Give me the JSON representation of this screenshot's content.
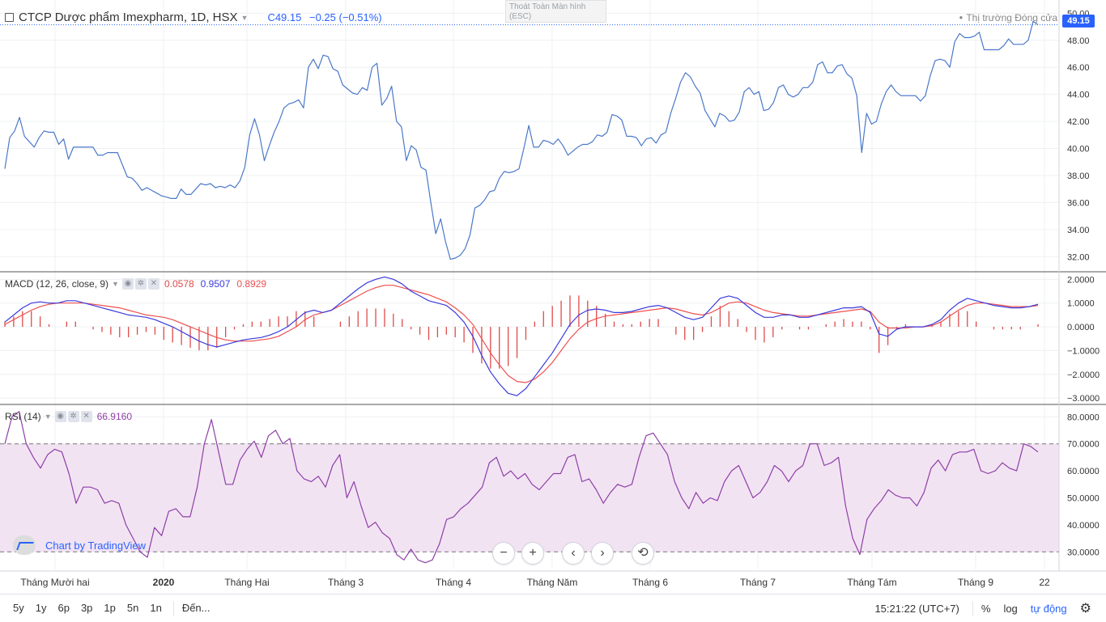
{
  "legend": {
    "symbol": "CTCP Dược phẩm Imexpharm, 1D, HSX",
    "close_label": "C",
    "close_value": "49.15",
    "change": "−0.25 (−0.51%)"
  },
  "fullscreen_hint": {
    "line1": "Thoát Toàn Màn hình",
    "line2": "(ESC)"
  },
  "market_status": "Thị trường Đóng cửa",
  "last_price_badge": "49.15",
  "macd_legend": {
    "label": "MACD (12, 26, close, 9)",
    "hist": "0.0578",
    "macd": "0.9507",
    "signal": "0.8929"
  },
  "rsi_legend": {
    "label": "RSI (14)",
    "value": "66.9160"
  },
  "watermark": "Chart by TradingView",
  "price_axis": [
    "50.00",
    "48.00",
    "46.00",
    "44.00",
    "42.00",
    "40.00",
    "38.00",
    "36.00",
    "34.00",
    "32.00"
  ],
  "macd_axis": [
    "2.0000",
    "1.0000",
    "0.0000",
    "−1.0000",
    "−2.0000",
    "−3.0000"
  ],
  "rsi_axis": [
    "80.0000",
    "70.0000",
    "60.0000",
    "50.0000",
    "40.0000",
    "30.0000"
  ],
  "time_axis": [
    "Tháng Mười hai",
    "2020",
    "Tháng Hai",
    "Tháng 3",
    "Tháng 4",
    "Tháng Năm",
    "Tháng 6",
    "Tháng 7",
    "Tháng Tám",
    "Tháng 9",
    "22"
  ],
  "nav_buttons": {
    "zoom_out": "−",
    "zoom_in": "+",
    "back": "‹",
    "forward": "›",
    "reset": "⟲"
  },
  "timeframes": [
    "5y",
    "1y",
    "6p",
    "3p",
    "1p",
    "5n",
    "1n"
  ],
  "goto_label": "Đến...",
  "clock": "15:21:22 (UTC+7)",
  "percent_label": "%",
  "log_label": "log",
  "auto_label": "tự động",
  "colors": {
    "price_line": "#4a78c9",
    "macd_line": "#3b3bdc",
    "signal_line": "#ef4f4f",
    "histogram": "#e04a4a",
    "rsi_line": "#8e3fa6",
    "rsi_band": "#f2e3f3",
    "accent": "#2962ff"
  },
  "chart_data": [
    {
      "type": "line",
      "name": "price",
      "ylim": [
        31,
        50.5
      ],
      "ytick_labels": [
        "50.00",
        "48.00",
        "46.00",
        "44.00",
        "42.00",
        "40.00",
        "38.00",
        "36.00",
        "34.00",
        "32.00"
      ],
      "values": [
        38.5,
        40.8,
        41.3,
        42.3,
        40.9,
        40.5,
        40.1,
        40.8,
        41.3,
        41.2,
        41.2,
        40.3,
        40.7,
        39.2,
        40.1,
        40.1,
        40.1,
        40.1,
        40.1,
        39.5,
        39.5,
        39.7,
        39.7,
        39.7,
        38.8,
        37.9,
        37.8,
        37.4,
        36.9,
        37.1,
        36.9,
        36.7,
        36.5,
        36.4,
        36.3,
        36.3,
        37.0,
        36.6,
        36.6,
        37.0,
        37.4,
        37.3,
        37.4,
        37.1,
        37.2,
        37.1,
        37.3,
        37.1,
        37.6,
        38.6,
        41.0,
        42.2,
        41.0,
        39.1,
        40.2,
        41.2,
        42.0,
        43.0,
        43.3,
        43.4,
        43.6,
        43.0,
        46.0,
        46.6,
        45.9,
        46.9,
        46.8,
        45.9,
        45.7,
        44.7,
        44.4,
        44.1,
        44.0,
        44.5,
        44.3,
        46.0,
        46.3,
        43.2,
        43.7,
        44.6,
        42.0,
        41.6,
        39.1,
        40.2,
        39.9,
        38.6,
        38.4,
        36.0,
        33.7,
        34.8,
        33.1,
        31.8,
        31.9,
        32.1,
        32.6,
        33.6,
        35.6,
        35.8,
        36.2,
        36.8,
        36.9,
        37.8,
        38.3,
        38.2,
        38.3,
        38.5,
        40.0,
        41.7,
        40.1,
        40.1,
        40.6,
        40.5,
        40.3,
        40.7,
        40.2,
        39.5,
        39.8,
        40.1,
        40.3,
        40.3,
        40.5,
        41.0,
        40.9,
        41.2,
        42.5,
        42.4,
        42.1,
        40.9,
        40.9,
        40.8,
        40.2,
        40.7,
        40.8,
        40.4,
        41.0,
        41.2,
        42.6,
        43.7,
        44.9,
        45.6,
        45.3,
        44.6,
        44.1,
        42.8,
        42.2,
        41.6,
        42.6,
        42.4,
        42.0,
        42.1,
        42.7,
        44.2,
        44.5,
        44.0,
        44.2,
        42.8,
        42.9,
        43.4,
        44.5,
        44.7,
        44.0,
        43.8,
        44.0,
        44.5,
        44.5,
        44.9,
        46.2,
        46.4,
        45.6,
        45.6,
        46.1,
        46.2,
        45.5,
        45.2,
        43.9,
        39.7,
        42.6,
        41.8,
        42.0,
        43.3,
        44.2,
        44.7,
        44.2,
        43.9,
        43.9,
        43.9,
        43.9,
        43.5,
        43.9,
        45.4,
        46.5,
        46.6,
        46.5,
        46.0,
        47.9,
        48.5,
        48.2,
        48.2,
        48.3,
        48.6,
        47.3,
        47.3,
        47.3,
        47.3,
        47.6,
        48.1,
        47.7,
        47.7,
        47.7,
        48.0,
        49.4,
        49.15
      ]
    },
    {
      "type": "line",
      "name": "macd",
      "ylim": [
        -3.2,
        2.25
      ],
      "ytick_labels": [
        "2.0000",
        "1.0000",
        "0.0000",
        "−1.0000",
        "−2.0000",
        "−3.0000"
      ],
      "macd_values": [
        0.2,
        0.5,
        0.8,
        1.0,
        1.05,
        1.0,
        1.0,
        1.1,
        1.1,
        1.0,
        0.9,
        0.8,
        0.7,
        0.6,
        0.5,
        0.45,
        0.4,
        0.3,
        0.15,
        0.0,
        -0.2,
        -0.4,
        -0.6,
        -0.75,
        -0.85,
        -0.75,
        -0.65,
        -0.55,
        -0.5,
        -0.45,
        -0.35,
        -0.2,
        0.0,
        0.3,
        0.6,
        0.7,
        0.6,
        0.7,
        1.0,
        1.3,
        1.6,
        1.85,
        2.0,
        2.1,
        2.0,
        1.8,
        1.5,
        1.3,
        1.1,
        1.0,
        0.9,
        0.6,
        0.2,
        -0.4,
        -1.2,
        -1.9,
        -2.4,
        -2.8,
        -2.9,
        -2.6,
        -2.1,
        -1.6,
        -1.1,
        -0.5,
        0.1,
        0.5,
        0.7,
        0.75,
        0.7,
        0.6,
        0.6,
        0.65,
        0.75,
        0.85,
        0.9,
        0.8,
        0.6,
        0.4,
        0.3,
        0.4,
        0.8,
        1.2,
        1.3,
        1.2,
        0.9,
        0.6,
        0.4,
        0.4,
        0.5,
        0.5,
        0.4,
        0.4,
        0.5,
        0.6,
        0.7,
        0.8,
        0.8,
        0.85,
        0.6,
        -0.3,
        -0.4,
        -0.1,
        0.0,
        0.0,
        0.0,
        0.1,
        0.3,
        0.7,
        1.0,
        1.2,
        1.1,
        1.0,
        0.9,
        0.85,
        0.8,
        0.8,
        0.85,
        0.95
      ],
      "signal_values": [
        0.1,
        0.3,
        0.5,
        0.7,
        0.85,
        0.95,
        1.0,
        1.0,
        1.0,
        1.0,
        0.95,
        0.9,
        0.85,
        0.8,
        0.7,
        0.6,
        0.5,
        0.45,
        0.4,
        0.3,
        0.15,
        0.0,
        -0.15,
        -0.3,
        -0.45,
        -0.55,
        -0.6,
        -0.6,
        -0.6,
        -0.55,
        -0.5,
        -0.4,
        -0.2,
        0.0,
        0.3,
        0.5,
        0.6,
        0.7,
        0.9,
        1.1,
        1.3,
        1.5,
        1.65,
        1.75,
        1.75,
        1.65,
        1.55,
        1.45,
        1.35,
        1.2,
        1.05,
        0.8,
        0.5,
        0.1,
        -0.5,
        -1.1,
        -1.6,
        -2.05,
        -2.3,
        -2.35,
        -2.2,
        -1.9,
        -1.5,
        -1.0,
        -0.5,
        -0.1,
        0.2,
        0.35,
        0.45,
        0.5,
        0.55,
        0.6,
        0.65,
        0.7,
        0.75,
        0.8,
        0.75,
        0.65,
        0.55,
        0.5,
        0.6,
        0.8,
        1.0,
        1.05,
        1.0,
        0.85,
        0.7,
        0.6,
        0.55,
        0.5,
        0.45,
        0.45,
        0.5,
        0.55,
        0.6,
        0.65,
        0.7,
        0.75,
        0.65,
        0.2,
        -0.05,
        -0.05,
        -0.05,
        0.0,
        0.0,
        0.05,
        0.2,
        0.45,
        0.7,
        0.9,
        1.0,
        1.0,
        0.95,
        0.9,
        0.85,
        0.85,
        0.85,
        0.9
      ]
    },
    {
      "type": "line",
      "name": "rsi",
      "ylim": [
        23.5,
        84
      ],
      "band": [
        30,
        70
      ],
      "ytick_labels": [
        "80.0000",
        "70.0000",
        "60.0000",
        "50.0000",
        "40.0000",
        "30.0000"
      ],
      "values": [
        70,
        80,
        82,
        70,
        65,
        61,
        66,
        68,
        67,
        59,
        48,
        54,
        54,
        53,
        48,
        49,
        48,
        40,
        35,
        30,
        28,
        39,
        36,
        45,
        46,
        43,
        43,
        54,
        70,
        79,
        67,
        55,
        55,
        64,
        68,
        71,
        65,
        73,
        75,
        70,
        72,
        60,
        57,
        56,
        58,
        54,
        62,
        66,
        50,
        56,
        47,
        39,
        41,
        37,
        35,
        29,
        27,
        31,
        27,
        26,
        27,
        33,
        42,
        43,
        46,
        48,
        51,
        54,
        63,
        65,
        58,
        60,
        57,
        59,
        55,
        53,
        56,
        59,
        59,
        65,
        66,
        56,
        57,
        53,
        48,
        52,
        55,
        54,
        55,
        65,
        73,
        74,
        70,
        66,
        56,
        50,
        46,
        52,
        48,
        50,
        49,
        56,
        60,
        62,
        56,
        50,
        52,
        56,
        62,
        60,
        56,
        60,
        62,
        70,
        70,
        62,
        63,
        65,
        47,
        35,
        29,
        42,
        46,
        49,
        53,
        51,
        50,
        50,
        47,
        52,
        61,
        64,
        60,
        66,
        67,
        67,
        68,
        60,
        59,
        60,
        63,
        61,
        60,
        70,
        69,
        67
      ]
    }
  ]
}
